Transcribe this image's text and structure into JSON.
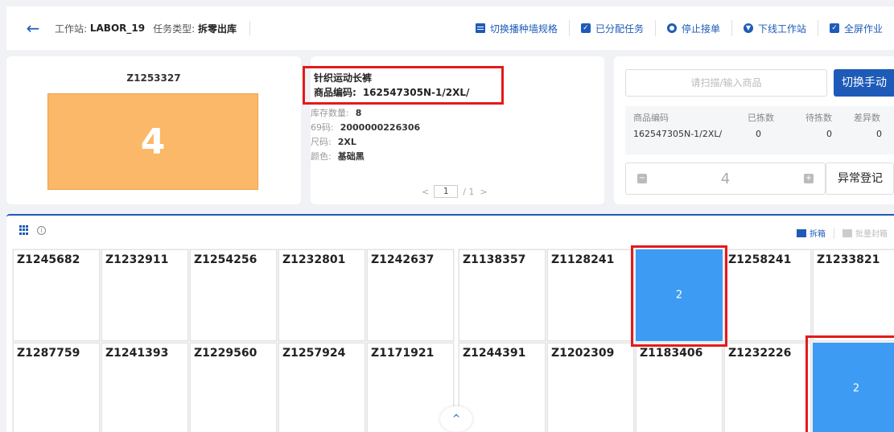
{
  "header": {
    "back_label": "←",
    "workstation_label": "工作站:",
    "workstation_value": "LABOR_19",
    "task_type_label": "任务类型:",
    "task_type_value": "拆零出库",
    "actions": [
      {
        "label": "切换播种墙规格",
        "icon": "grid-icon"
      },
      {
        "label": "已分配任务",
        "icon": "check-icon"
      },
      {
        "label": "停止接单",
        "icon": "stop-circle-icon"
      },
      {
        "label": "下线工作站",
        "icon": "download-circle-icon"
      },
      {
        "label": "全屏作业",
        "icon": "fullscreen-check-icon"
      }
    ]
  },
  "slot_card": {
    "code": "Z1253327",
    "quantity": "4"
  },
  "product_card": {
    "name": "针织运动长裤",
    "code_label": "商品编码:",
    "code_value": "162547305N-1/2XL/",
    "stock_label": "库存数量:",
    "stock_value": "8",
    "barcode_label": "69码:",
    "barcode_value": "2000000226306",
    "size_label": "尺码:",
    "size_value": "2XL",
    "color_label": "颜色:",
    "color_value": "基础黑",
    "pager_prev": "<",
    "pager_current": "1",
    "pager_total": "/ 1",
    "pager_next": ">"
  },
  "scan_card": {
    "placeholder": "请扫描/输入商品",
    "switch_label": "切换手动",
    "table_headers": [
      "商品编码",
      "已拣数",
      "待拣数",
      "差异数"
    ],
    "table_rows": [
      [
        "162547305N-1/2XL/",
        "0",
        "0",
        "0"
      ]
    ],
    "stepper_minus": "−",
    "stepper_value": "4",
    "stepper_plus": "+",
    "abnormal_label": "异常登记"
  },
  "wall": {
    "unpack_label": "拆箱",
    "batch_label": "批量封箱",
    "row1": [
      {
        "code": "Z1245682",
        "qty": ""
      },
      {
        "code": "Z1232911",
        "qty": ""
      },
      {
        "code": "Z1254256",
        "qty": ""
      },
      {
        "code": "Z1232801",
        "qty": ""
      },
      {
        "code": "Z1242637",
        "qty": ""
      },
      {
        "code": "Z1138357",
        "qty": ""
      },
      {
        "code": "Z1128241",
        "qty": ""
      },
      {
        "code": "",
        "qty": "2"
      },
      {
        "code": "Z1258241",
        "qty": ""
      },
      {
        "code": "Z1233821",
        "qty": ""
      }
    ],
    "row2": [
      {
        "code": "Z1287759",
        "qty": ""
      },
      {
        "code": "Z1241393",
        "qty": ""
      },
      {
        "code": "Z1229560",
        "qty": ""
      },
      {
        "code": "Z1257924",
        "qty": ""
      },
      {
        "code": "Z1171921",
        "qty": ""
      },
      {
        "code": "Z1244391",
        "qty": ""
      },
      {
        "code": "Z1202309",
        "qty": ""
      },
      {
        "code": "Z1183406",
        "qty": ""
      },
      {
        "code": "Z1232226",
        "qty": ""
      },
      {
        "code": "",
        "qty": "2"
      }
    ],
    "scroll_up": "^"
  },
  "colors": {
    "primary": "#1e5bb8",
    "slot_orange": "#fbb868",
    "slot_filled": "#3d9bf3",
    "highlight": "#e41a1a"
  }
}
